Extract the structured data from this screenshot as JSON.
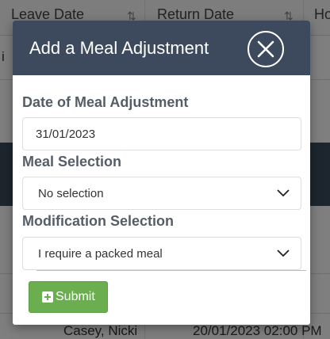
{
  "background": {
    "columns": [
      "Leave Date",
      "Return Date",
      "Ho"
    ],
    "row_fragment": "i",
    "last_row": {
      "name": "Casey, Nicki",
      "datetime": "20/01/2023 02:00 PM"
    }
  },
  "modal": {
    "title": "Add a Meal Adjustment",
    "close_icon": "close-icon",
    "date_label": "Date of Meal Adjustment",
    "date_value": "31/01/2023",
    "meal_label": "Meal Selection",
    "meal_value": "No selection",
    "modification_label": "Modification Selection",
    "modification_value": "I require a packed meal",
    "submit_label": "Submit",
    "submit_icon": "plus-square-icon"
  },
  "colors": {
    "header": "#3d4a5d",
    "submit": "#6aae4f",
    "overlay": "rgba(0,0,0,0.5)"
  }
}
